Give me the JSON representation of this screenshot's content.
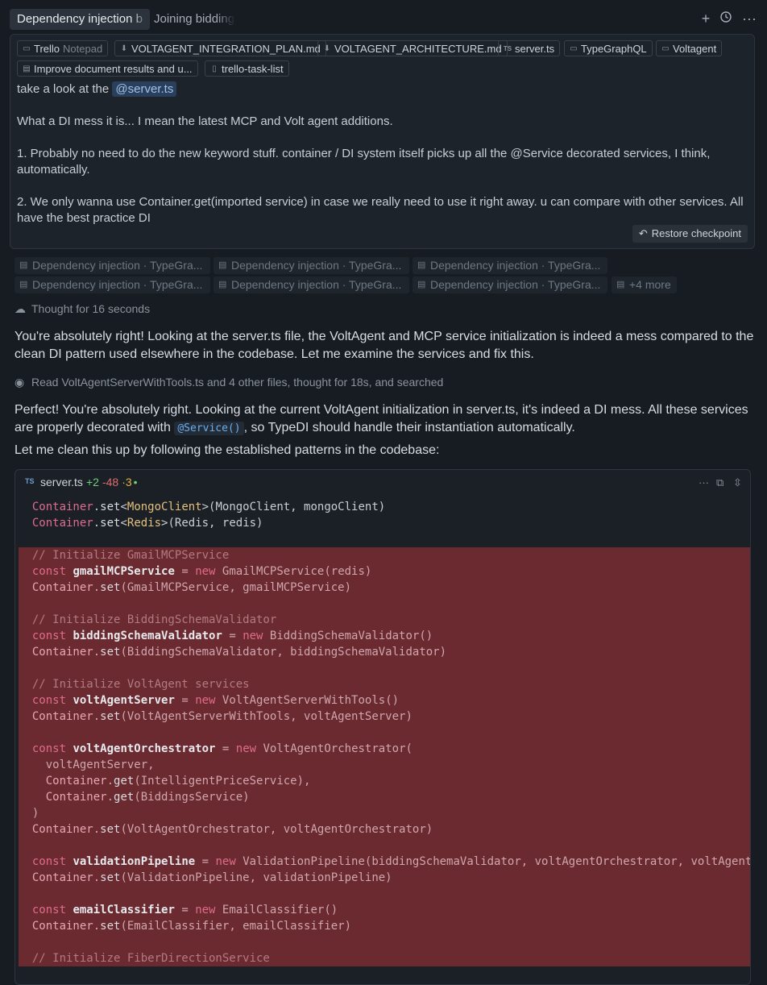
{
  "tabs": [
    {
      "label": "Dependency injection b",
      "active": true
    },
    {
      "label": "Joining bidding",
      "active": false
    }
  ],
  "top_icons": [
    "plus-icon",
    "history-icon",
    "more-icon"
  ],
  "context_chips": [
    {
      "icon": "book",
      "label": "Trello",
      "sub": "Notepad"
    },
    {
      "icon": "download",
      "label": "VOLTAGENT_INTEGRATION_PLAN.md"
    },
    {
      "icon": "download",
      "label": "VOLTAGENT_ARCHITECTURE.md"
    },
    {
      "icon": "ts",
      "label": "server.ts"
    },
    {
      "icon": "book",
      "label": "TypeGraphQL"
    },
    {
      "icon": "book",
      "label": "Voltagent"
    },
    {
      "icon": "doc",
      "label": "Improve document results and u..."
    },
    {
      "icon": "file",
      "label": "trello-task-list"
    }
  ],
  "message": {
    "line1_prefix": "take a look at the",
    "mention": "@server.ts",
    "line2": "What a DI mess it is... I mean the latest MCP and Volt agent additions.",
    "line3": "1. Probably no need to do the new keyword stuff. container / DI system itself picks up all the @Service decorated services, I think, automatically.",
    "line4": "2. We only wanna use Container.get(imported service) in case we really need to use it right away. u can compare with other services. All have the best practice DI"
  },
  "restore_label": "Restore checkpoint",
  "dep_chips": [
    "Dependency injection · TypeGra...",
    "Dependency injection · TypeGra...",
    "Dependency injection · TypeGra...",
    "Dependency injection · TypeGra...",
    "Dependency injection · TypeGra...",
    "Dependency injection · TypeGra..."
  ],
  "dep_more": "+4 more",
  "thought1": "Thought for 16 seconds",
  "para1": "You're absolutely right! Looking at the server.ts file, the VoltAgent and MCP service initialization is indeed a mess compared to the clean DI pattern used elsewhere in the codebase. Let me examine the services and fix this.",
  "read_line": "Read VoltAgentServerWithTools.ts and 4 other files, thought for 18s, and searched",
  "para2_a": "Perfect! You're absolutely right. Looking at the current VoltAgent initialization in server.ts, it's indeed a DI mess. All these services are properly decorated with",
  "para2_code": "@Service()",
  "para2_b": ", so TypeDI should handle their instantiation automatically.",
  "para3": "Let me clean this up by following the established patterns in the codebase:",
  "code": {
    "filename": "server.ts",
    "added": "+2",
    "removed": "-48",
    "modified": "·3",
    "dot": "•",
    "lines": [
      {
        "t": "  Container.set<MongoClient>(MongoClient, mongoClient)",
        "del": false
      },
      {
        "t": "  Container.set<Redis>(Redis, redis)",
        "del": false
      },
      {
        "t": "",
        "del": false
      },
      {
        "t": "  // Initialize GmailMCPService",
        "del": true
      },
      {
        "t": "  const gmailMCPService = new GmailMCPService(redis)",
        "del": true
      },
      {
        "t": "  Container.set(GmailMCPService, gmailMCPService)",
        "del": true
      },
      {
        "t": "",
        "del": true
      },
      {
        "t": "  // Initialize BiddingSchemaValidator",
        "del": true
      },
      {
        "t": "  const biddingSchemaValidator = new BiddingSchemaValidator()",
        "del": true
      },
      {
        "t": "  Container.set(BiddingSchemaValidator, biddingSchemaValidator)",
        "del": true
      },
      {
        "t": "",
        "del": true
      },
      {
        "t": "  // Initialize VoltAgent services",
        "del": true
      },
      {
        "t": "  const voltAgentServer = new VoltAgentServerWithTools()",
        "del": true
      },
      {
        "t": "  Container.set(VoltAgentServerWithTools, voltAgentServer)",
        "del": true
      },
      {
        "t": "",
        "del": true
      },
      {
        "t": "  const voltAgentOrchestrator = new VoltAgentOrchestrator(",
        "del": true
      },
      {
        "t": "    voltAgentServer,",
        "del": true
      },
      {
        "t": "    Container.get(IntelligentPriceService),",
        "del": true
      },
      {
        "t": "    Container.get(BiddingsService)",
        "del": true
      },
      {
        "t": "  )",
        "del": true
      },
      {
        "t": "  Container.set(VoltAgentOrchestrator, voltAgentOrchestrator)",
        "del": true
      },
      {
        "t": "",
        "del": true
      },
      {
        "t": "  const validationPipeline = new ValidationPipeline(biddingSchemaValidator, voltAgentOrchestrator, voltAgentS",
        "del": true
      },
      {
        "t": "  Container.set(ValidationPipeline, validationPipeline)",
        "del": true
      },
      {
        "t": "",
        "del": true
      },
      {
        "t": "  const emailClassifier = new EmailClassifier()",
        "del": true
      },
      {
        "t": "  Container.set(EmailClassifier, emailClassifier)",
        "del": true
      },
      {
        "t": "",
        "del": true
      },
      {
        "t": "  // Initialize FiberDirectionService",
        "del": true
      }
    ]
  }
}
